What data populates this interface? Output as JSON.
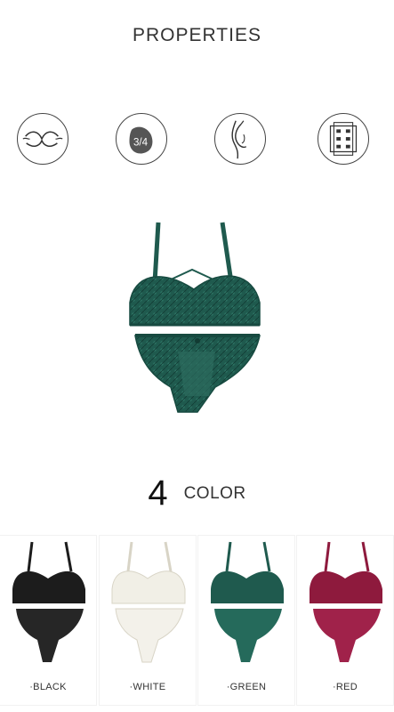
{
  "header": {
    "title": "PROPERTIES"
  },
  "properties": {
    "icons": [
      {
        "name": "push-up-icon"
      },
      {
        "name": "three-quarter-cup-icon",
        "label": "3/4"
      },
      {
        "name": "side-support-icon"
      },
      {
        "name": "hook-closure-icon"
      }
    ]
  },
  "product": {
    "color_hex": "#1f5a4e"
  },
  "colors_section": {
    "count": "4",
    "label": "COLOR"
  },
  "variants": [
    {
      "label": "·BLACK",
      "hex": "#1c1c1c"
    },
    {
      "label": "·WHITE",
      "hex": "#f1efe6"
    },
    {
      "label": "·GREEN",
      "hex": "#1f5a4e"
    },
    {
      "label": "·RED",
      "hex": "#8e1a3d"
    }
  ]
}
